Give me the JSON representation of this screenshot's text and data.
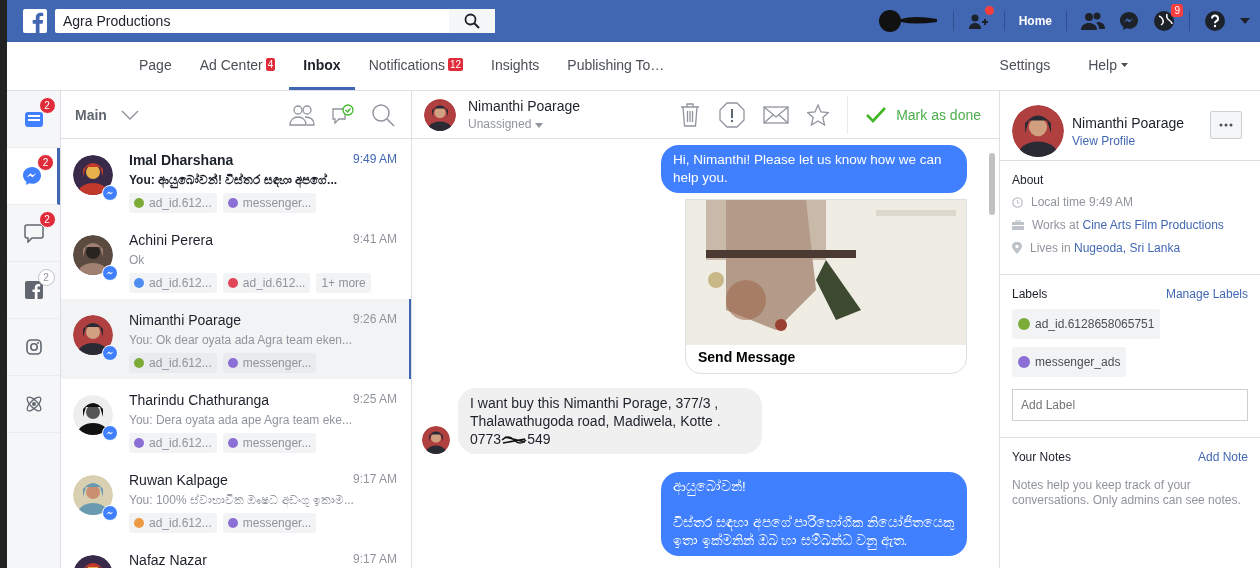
{
  "top_bar": {
    "search": {
      "value": "Agra Productions"
    },
    "home": "Home",
    "globe_badge": "9",
    "friend_dot": true
  },
  "nav": {
    "tabs": [
      {
        "label": "Page",
        "selected": false
      },
      {
        "label": "Ad Center",
        "badge": "4",
        "selected": false
      },
      {
        "label": "Inbox",
        "selected": true
      },
      {
        "label": "Notifications",
        "badge": "12",
        "selected": false
      },
      {
        "label": "Insights",
        "selected": false
      },
      {
        "label": "Publishing To…",
        "selected": false
      }
    ],
    "settings": "Settings",
    "help": "Help"
  },
  "rail": [
    {
      "kind": "inbox",
      "badge": "2",
      "badge_outline": false,
      "selected": false
    },
    {
      "kind": "messenger",
      "badge": "2",
      "badge_outline": false,
      "selected": true
    },
    {
      "kind": "comments",
      "badge": "2",
      "badge_outline": false,
      "selected": false
    },
    {
      "kind": "facebook",
      "badge": "2",
      "badge_outline": true,
      "selected": false
    },
    {
      "kind": "instagram",
      "selected": false
    },
    {
      "kind": "atom",
      "selected": false
    }
  ],
  "list": {
    "title": "Main",
    "conversations": [
      {
        "name": "Imal Dharshana",
        "time": "9:49 AM",
        "preview": "You: ආයුබෝවන්! විස්තර සඳහා අපගේ...",
        "unread": true,
        "selected": false,
        "tags": [
          {
            "text": "ad_id.612...",
            "color": "#7cab38"
          },
          {
            "text": "messenger...",
            "color": "#8c6fd4"
          }
        ]
      },
      {
        "name": "Achini Perera",
        "time": "9:41 AM",
        "preview": "Ok",
        "unread": false,
        "selected": false,
        "tags": [
          {
            "text": "ad_id.612...",
            "color": "#4f8ef0"
          },
          {
            "text": "ad_id.612...",
            "color": "#e0485a"
          },
          {
            "text": "1+ more"
          }
        ]
      },
      {
        "name": "Nimanthi Poarage",
        "time": "9:26 AM",
        "preview": "You: Ok dear oyata ada Agra team eken...",
        "unread": false,
        "selected": true,
        "tags": [
          {
            "text": "ad_id.612...",
            "color": "#7cab38"
          },
          {
            "text": "messenger...",
            "color": "#8c6fd4"
          }
        ]
      },
      {
        "name": "Tharindu Chathuranga",
        "time": "9:25 AM",
        "preview": "You: Dera oyata ada ape Agra team eke...",
        "unread": false,
        "selected": false,
        "tags": [
          {
            "text": "ad_id.612...",
            "color": "#8c6fd4"
          },
          {
            "text": "messenger...",
            "color": "#8c6fd4"
          }
        ]
      },
      {
        "name": "Ruwan Kalpage",
        "time": "9:17 AM",
        "preview": "You: 100% ස්වාභාවික ඖෂධ අඩංගු ඉකාම...",
        "unread": false,
        "selected": false,
        "tags": [
          {
            "text": "ad_id.612...",
            "color": "#ee9a44"
          },
          {
            "text": "messenger...",
            "color": "#8c6fd4"
          }
        ]
      },
      {
        "name": "Nafaz Nazar",
        "time": "9:17 AM",
        "unread": false,
        "selected": false
      }
    ]
  },
  "chat": {
    "name": "Nimanthi Poarage",
    "assignee": "Unassigned",
    "mark_done": "Mark as done",
    "messages": [
      {
        "kind": "outgoing",
        "paragraphs": [
          "Hi, Nimanthi! Please let us know how we can help you."
        ]
      },
      {
        "kind": "card",
        "button": "Send Message"
      },
      {
        "kind": "incoming",
        "paragraphs": [
          "I want buy this  Nimanthi Porage,  377/3 , Thalawathugoda road,  Madiwela, Kotte  . 0773"
        ],
        "redacted_end": "549"
      },
      {
        "kind": "outgoing",
        "paragraphs": [
          "ආයුබෝවන්!",
          "විස්තර සඳහා අපගේ පාරිභෝගික නියෝජිතයෙකු ඉතා ඉක්මනින් ඔබ හා සම්බන්ධ වනු ඇත."
        ]
      }
    ]
  },
  "profile": {
    "name": "Nimanthi Poarage",
    "view_profile": "View Profile",
    "about": {
      "title": "About",
      "local_time": "Local time 9:49 AM",
      "works_prefix": "Works at",
      "works_link": "Cine Arts Film Productions",
      "lives_prefix": "Lives in",
      "lives_link": "Nugeoda, Sri Lanka"
    },
    "labels": {
      "title": "Labels",
      "manage": "Manage Labels",
      "items": [
        {
          "text": "ad_id.6128658065751",
          "color": "#7cab38"
        },
        {
          "text": "messenger_ads",
          "color": "#8c6fd4"
        }
      ],
      "placeholder": "Add Label"
    },
    "notes": {
      "title": "Your Notes",
      "add": "Add Note",
      "text": "Notes help you keep track of your conversations. Only admins can see notes."
    }
  }
}
